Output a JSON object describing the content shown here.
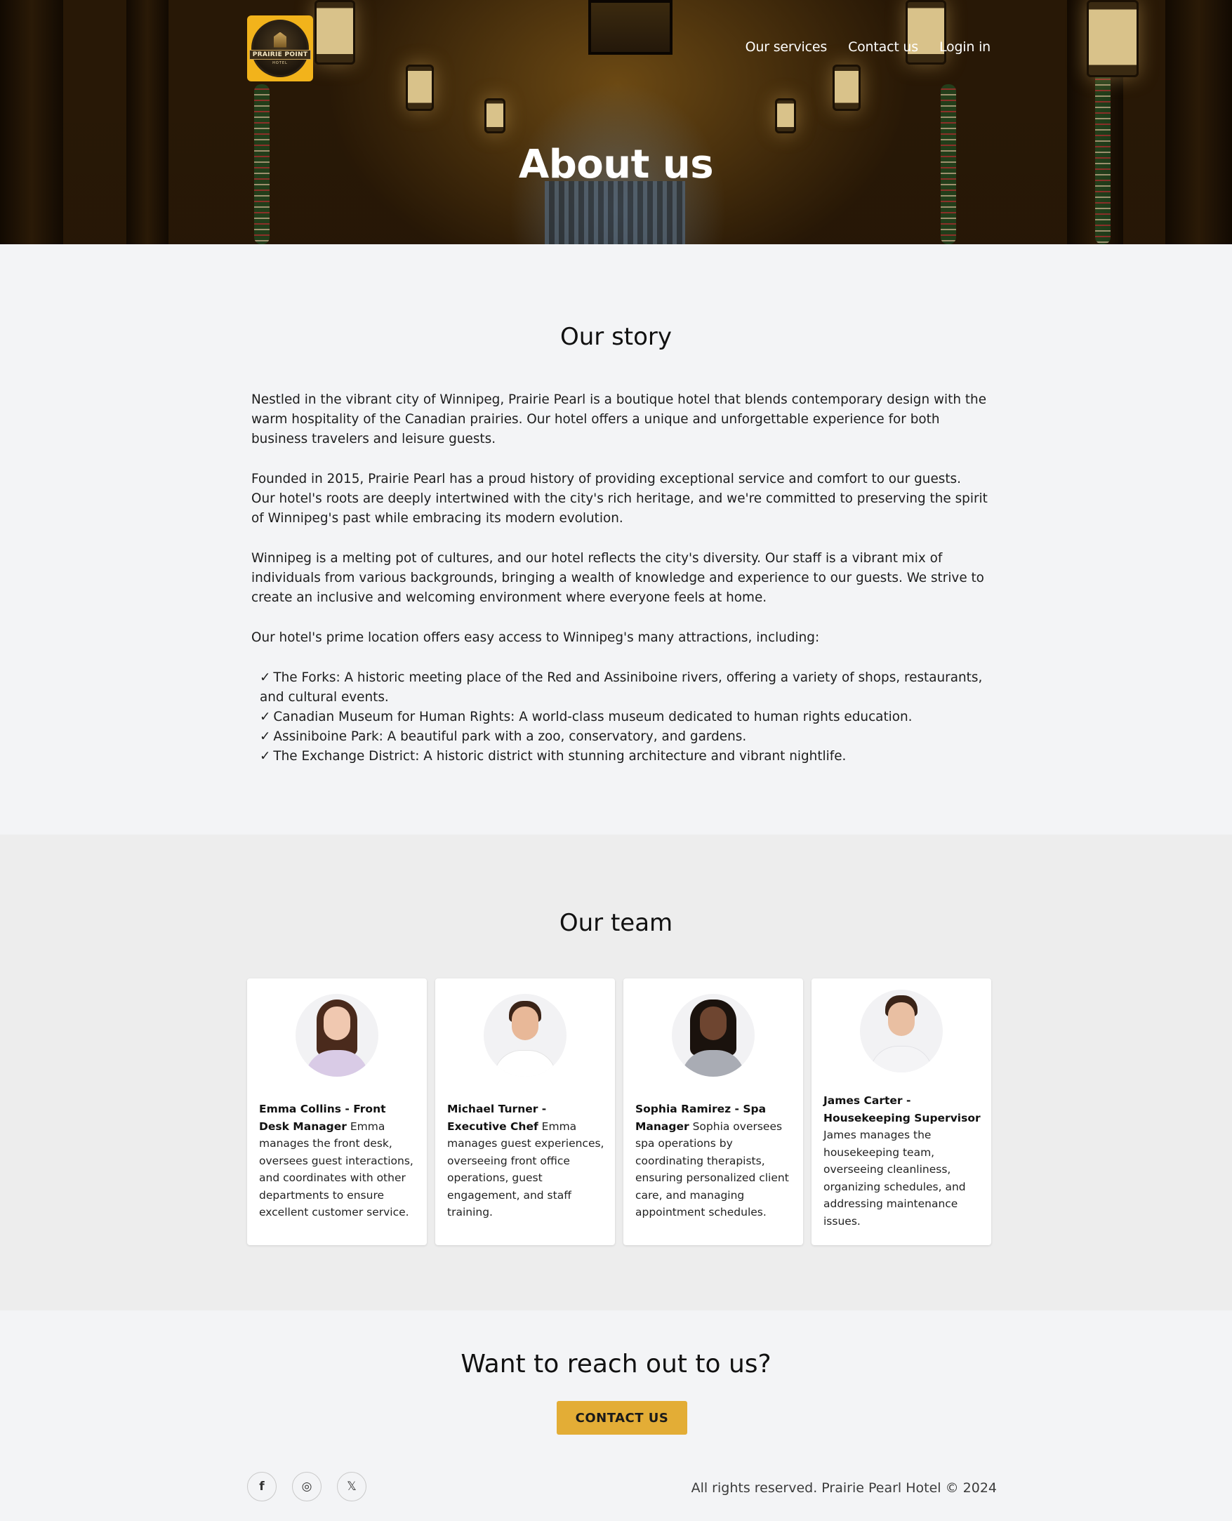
{
  "header": {
    "logo_text": "PRAIRIE POINT",
    "logo_subtext": "HOTEL",
    "nav": [
      {
        "label": "Our services"
      },
      {
        "label": "Contact us"
      },
      {
        "label": "Login in"
      }
    ],
    "hero_title": "About us"
  },
  "story": {
    "title": "Our story",
    "paragraphs": [
      "Nestled in the vibrant city of Winnipeg, Prairie Pearl is a boutique hotel that blends contemporary design with the warm hospitality of the Canadian prairies. Our hotel offers a unique and unforgettable experience for both business travelers and leisure guests.",
      "Founded in 2015, Prairie Pearl has a proud history of providing exceptional service and comfort to our guests. Our hotel's roots are deeply intertwined with the city's rich heritage, and we're committed to preserving the spirit of Winnipeg's past while embracing its modern evolution.",
      "Winnipeg is a melting pot of cultures, and our hotel reflects the city's diversity. Our staff is a vibrant mix of individuals from various backgrounds, bringing a wealth of knowledge and experience to our guests. We strive to create an inclusive and welcoming environment where everyone feels at home.",
      "Our hotel's prime location offers easy access to Winnipeg's many attractions, including:"
    ],
    "attractions": [
      "The Forks: A historic meeting place of the Red and Assiniboine rivers, offering a variety of shops, restaurants, and cultural events.",
      "Canadian Museum for Human Rights: A world-class museum dedicated to human rights education.",
      "Assiniboine Park: A beautiful park with a zoo, conservatory, and gardens.",
      "The Exchange District: A historic district with stunning architecture and vibrant nightlife."
    ]
  },
  "team": {
    "title": "Our team",
    "members": [
      {
        "name": "Emma Collins - Front Desk Manager",
        "bio": "Emma manages the front desk, oversees guest interactions, and coordinates with other departments to ensure excellent customer service."
      },
      {
        "name": "Michael Turner - Executive Chef",
        "bio": "Emma manages guest experiences, overseeing front office operations, guest engagement, and staff training."
      },
      {
        "name": "Sophia Ramirez - Spa Manager",
        "bio": "Sophia oversees spa operations by coordinating therapists, ensuring personalized client care, and managing appointment schedules."
      },
      {
        "name": "James Carter - Housekeeping Supervisor",
        "bio": "James manages the housekeeping team, overseeing cleanliness, organizing schedules, and addressing maintenance issues."
      }
    ]
  },
  "cta": {
    "title": "Want to reach out to us?",
    "button_label": "CONTACT US"
  },
  "footer": {
    "socials": [
      {
        "icon": "facebook-icon",
        "glyph": "f"
      },
      {
        "icon": "instagram-icon",
        "glyph": "◎"
      },
      {
        "icon": "x-icon",
        "glyph": "𝕏"
      }
    ],
    "copyright": "All rights reserved. Prairie Pearl Hotel © 2024"
  },
  "colors": {
    "accent": "#e3ad36",
    "logo_bg": "#f2b31b",
    "page_bg": "#f3f4f6",
    "team_bg": "#ededed"
  }
}
